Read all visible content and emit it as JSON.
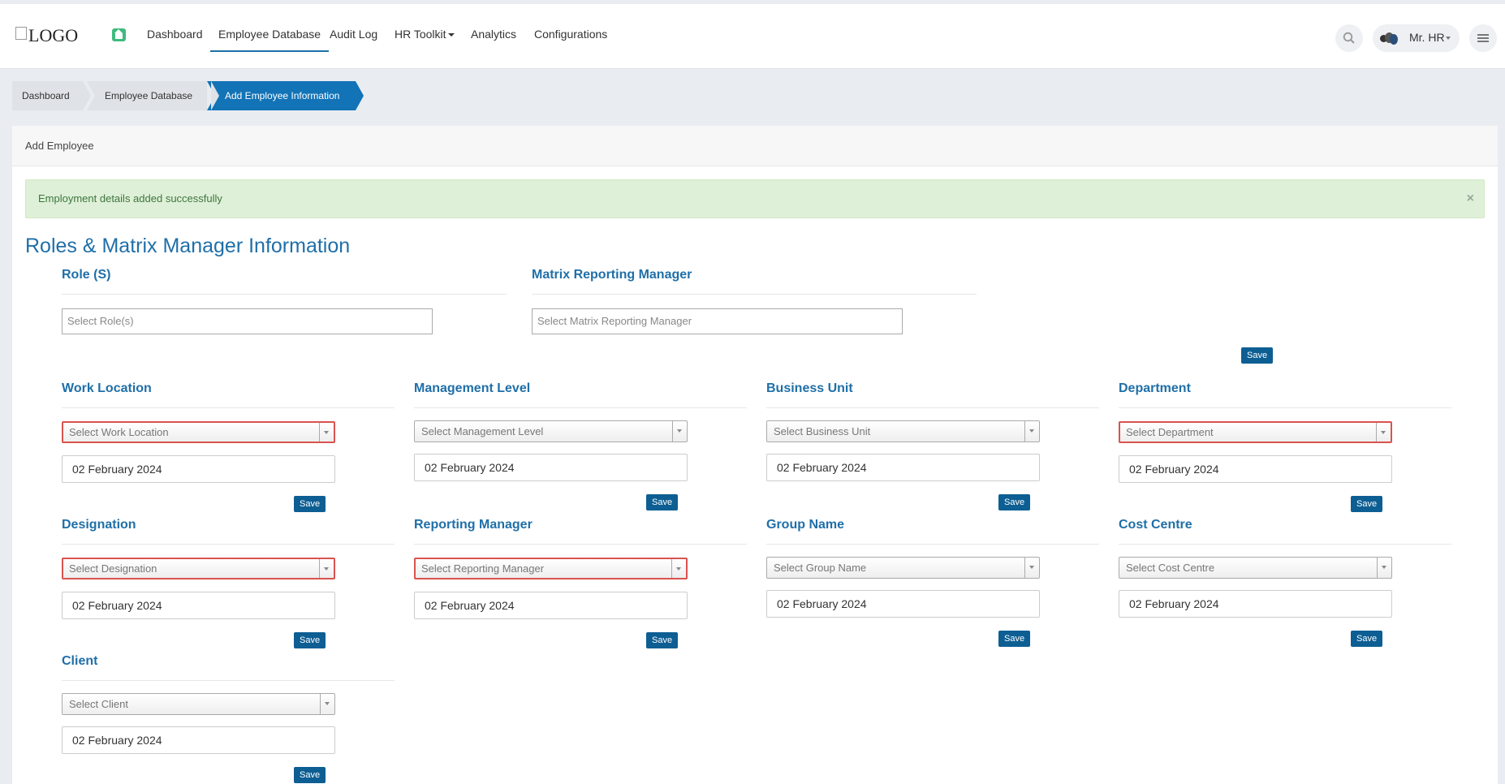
{
  "header": {
    "logo_alt": "LOGO",
    "nav": [
      "Dashboard",
      "Employee Database",
      "Audit Log",
      "HR Toolkit",
      "Analytics",
      "Configurations"
    ],
    "active_nav": "Employee Database",
    "user_name": "Mr. HR"
  },
  "breadcrumb": [
    "Dashboard",
    "Employee Database",
    "Add Employee Information"
  ],
  "panel": {
    "title": "Add Employee",
    "alert": "Employment details added successfully",
    "alert_close": "×",
    "section_title": "Roles & Matrix Manager Information"
  },
  "roles": {
    "role_label": "Role (S)",
    "role_placeholder": "Select Role(s)",
    "matrix_label": "Matrix Reporting Manager",
    "matrix_placeholder": "Select Matrix Reporting Manager",
    "save": "Save"
  },
  "fields": [
    {
      "label": "Work Location",
      "placeholder": "Select Work Location",
      "date": "02 February 2024",
      "save": "Save",
      "error": true
    },
    {
      "label": "Management Level",
      "placeholder": "Select Management Level",
      "date": "02 February 2024",
      "save": "Save",
      "error": false
    },
    {
      "label": "Business Unit",
      "placeholder": "Select Business Unit",
      "date": "02 February 2024",
      "save": "Save",
      "error": false
    },
    {
      "label": "Department",
      "placeholder": "Select Department",
      "date": "02 February 2024",
      "save": "Save",
      "error": true
    },
    {
      "label": "Designation",
      "placeholder": "Select Designation",
      "date": "02 February 2024",
      "save": "Save",
      "error": true
    },
    {
      "label": "Reporting Manager",
      "placeholder": "Select Reporting Manager",
      "date": "02 February 2024",
      "save": "Save",
      "error": true
    },
    {
      "label": "Group Name",
      "placeholder": "Select Group Name",
      "date": "02 February 2024",
      "save": "Save",
      "error": false
    },
    {
      "label": "Cost Centre",
      "placeholder": "Select Cost Centre",
      "date": "02 February 2024",
      "save": "Save",
      "error": false
    },
    {
      "label": "Client",
      "placeholder": "Select Client",
      "date": "02 February 2024",
      "save": "Save",
      "error": false
    }
  ],
  "colors": {
    "accent": "#1f6fa8",
    "active_crumb": "#1273b7",
    "save_button": "#0d5e93",
    "success_bg": "#dff0d8",
    "error_border": "#d9534f"
  }
}
